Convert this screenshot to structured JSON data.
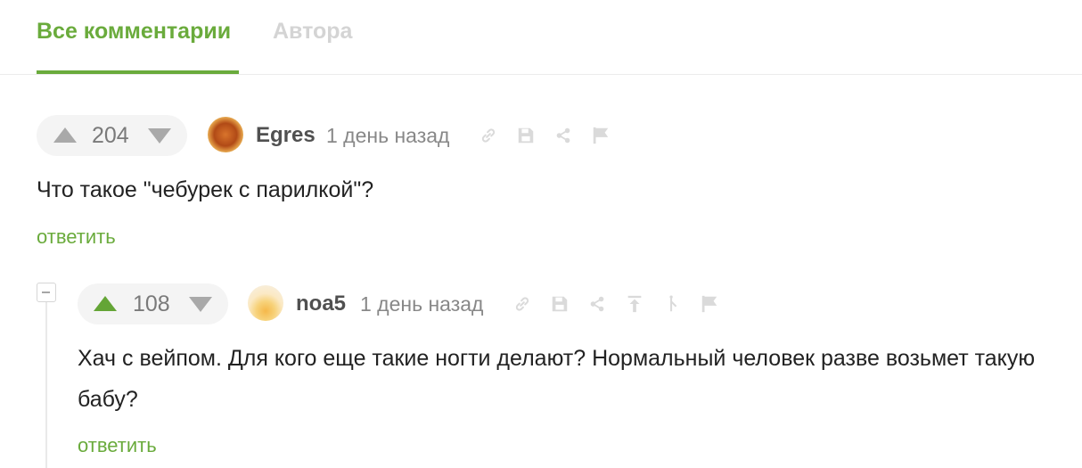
{
  "tabs": {
    "all_comments": "Все комментарии",
    "author": "Автора"
  },
  "comments": [
    {
      "rating": "204",
      "vote_state": "none",
      "username": "Egres",
      "time": "1 день назад",
      "text": "Что такое \"чебурек с парилкой\"?",
      "reply_label": "ответить",
      "actions": [
        "link-icon",
        "save-icon",
        "share-icon",
        "flag-icon"
      ]
    },
    {
      "rating": "108",
      "vote_state": "up",
      "username": "noa5",
      "time": "1 день назад",
      "text": "Хач с вейпом. Для кого еще такие ногти делают? Нормальный человек разве возьмет такую бабу?",
      "reply_label": "ответить",
      "actions": [
        "link-icon",
        "save-icon",
        "share-icon",
        "go-to-parent-icon",
        "branch-icon",
        "flag-icon"
      ]
    }
  ],
  "colors": {
    "accent_green": "#6aab3c",
    "upvote_active": "#64a536",
    "vote_inactive": "#a9a9a9",
    "action_icons": "#dadada"
  }
}
